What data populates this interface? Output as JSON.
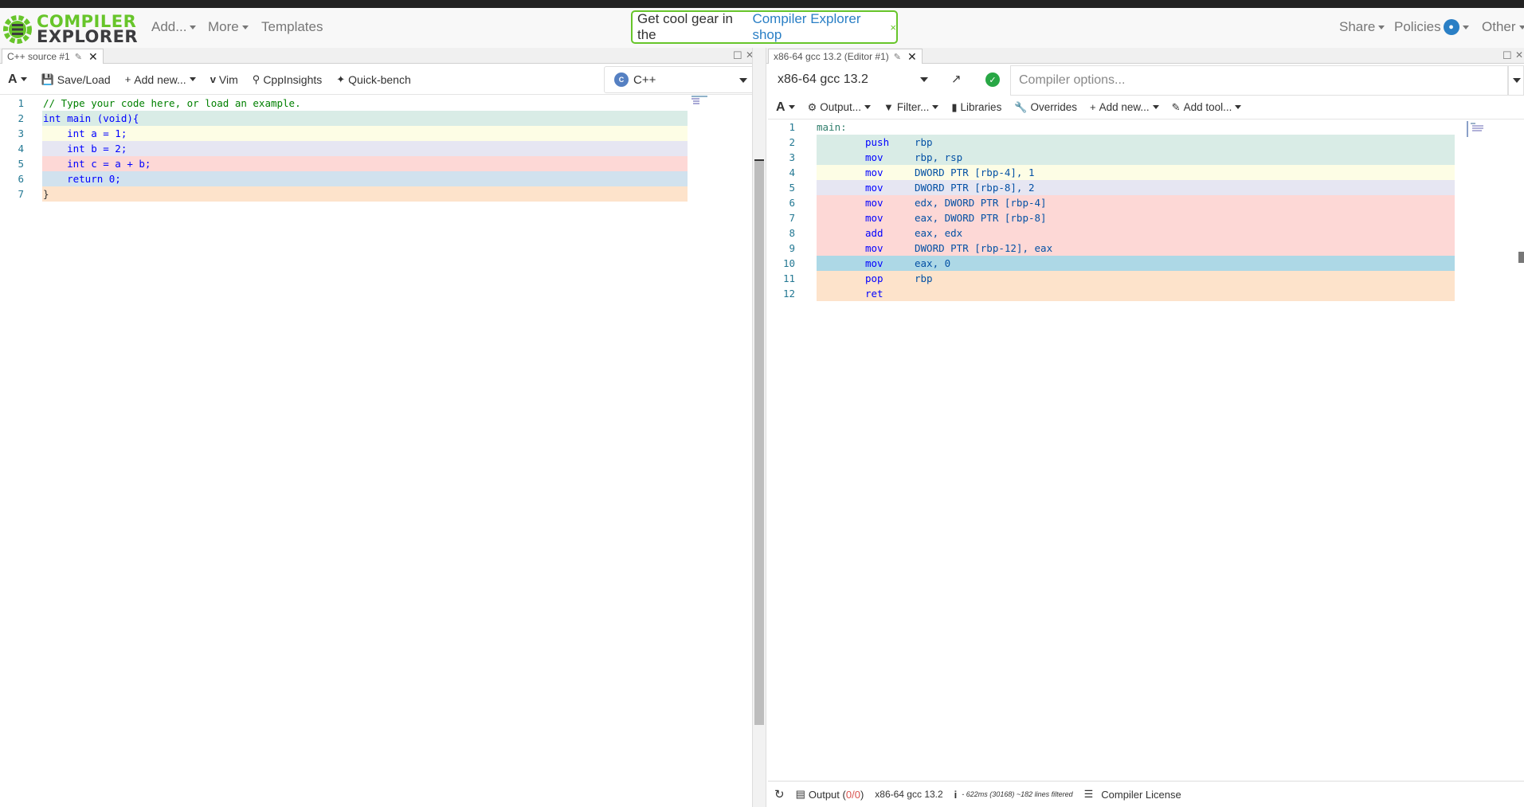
{
  "nav": {
    "logo_line1": "COMPILER",
    "logo_line2": "EXPLORER",
    "add": "Add...",
    "more": "More",
    "templates": "Templates",
    "shop_text": "Get cool gear in the",
    "shop_link": "Compiler Explorer shop",
    "shop_close": "×",
    "share": "Share",
    "policies": "Policies",
    "other": "Other"
  },
  "source_pane": {
    "tab_title": "C++ source #1",
    "toolbar": {
      "font": "A",
      "save_load": "Save/Load",
      "add_new": "Add new...",
      "vim": "Vim",
      "cppinsights": "CppInsights",
      "quickbench": "Quick-bench"
    },
    "language": "C++",
    "lines": [
      {
        "n": "1",
        "text": "// Type your code here, or load an example.",
        "bg": "",
        "color": "#008000"
      },
      {
        "n": "2",
        "text": "int main (void){",
        "bg": "#d9ece6",
        "color": "#0000ff"
      },
      {
        "n": "3",
        "text": "    int a = 1;",
        "bg": "#fdfde5",
        "color": "#0000ff"
      },
      {
        "n": "4",
        "text": "    int b = 2;",
        "bg": "#e6e6f2",
        "color": "#0000ff"
      },
      {
        "n": "5",
        "text": "    int c = a + b;",
        "bg": "#fdd8d6",
        "color": "#0000ff"
      },
      {
        "n": "6",
        "text": "    return 0;",
        "bg": "#d1e2ee",
        "color": "#0000ff"
      },
      {
        "n": "7",
        "text": "}",
        "bg": "#fde3cb",
        "color": "#333333"
      }
    ]
  },
  "compiler_pane": {
    "tab_title": "x86-64 gcc 13.2 (Editor #1)",
    "compiler": "x86-64 gcc 13.2",
    "options_placeholder": "Compiler options...",
    "toolbar": {
      "font": "A",
      "output": "Output...",
      "filter": "Filter...",
      "libraries": "Libraries",
      "overrides": "Overrides",
      "add_new": "Add new...",
      "add_tool": "Add tool..."
    },
    "asm": [
      {
        "n": "1",
        "label": "main:",
        "op": "",
        "args": "",
        "bg": ""
      },
      {
        "n": "2",
        "label": "",
        "op": "push",
        "args": "rbp",
        "bg": "#d9ece6"
      },
      {
        "n": "3",
        "label": "",
        "op": "mov",
        "args": "rbp, rsp",
        "bg": "#d9ece6"
      },
      {
        "n": "4",
        "label": "",
        "op": "mov",
        "args": "DWORD PTR [rbp-4], 1",
        "bg": "#fdfde5"
      },
      {
        "n": "5",
        "label": "",
        "op": "mov",
        "args": "DWORD PTR [rbp-8], 2",
        "bg": "#e6e6f2"
      },
      {
        "n": "6",
        "label": "",
        "op": "mov",
        "args": "edx, DWORD PTR [rbp-4]",
        "bg": "#fdd8d6"
      },
      {
        "n": "7",
        "label": "",
        "op": "mov",
        "args": "eax, DWORD PTR [rbp-8]",
        "bg": "#fdd8d6"
      },
      {
        "n": "8",
        "label": "",
        "op": "add",
        "args": "eax, edx",
        "bg": "#fdd8d6"
      },
      {
        "n": "9",
        "label": "",
        "op": "mov",
        "args": "DWORD PTR [rbp-12], eax",
        "bg": "#fdd8d6"
      },
      {
        "n": "10",
        "label": "",
        "op": "mov",
        "args": "eax, 0",
        "bg": "#add8e6"
      },
      {
        "n": "11",
        "label": "",
        "op": "pop",
        "args": "rbp",
        "bg": "#fde3cb"
      },
      {
        "n": "12",
        "label": "",
        "op": "ret",
        "args": "",
        "bg": "#fde3cb"
      }
    ],
    "status": {
      "output_label": "Output (",
      "output_ok": "0",
      "output_sep": "/",
      "output_err": "0",
      "output_end": ")",
      "compiler": "x86-64 gcc 13.2",
      "info_icon": "i",
      "timing": "- 622ms (30168) ~182 lines filtered",
      "license": "Compiler License"
    }
  },
  "colors": {
    "brand_green": "#67c52a",
    "link_blue": "#2a7fc5"
  }
}
